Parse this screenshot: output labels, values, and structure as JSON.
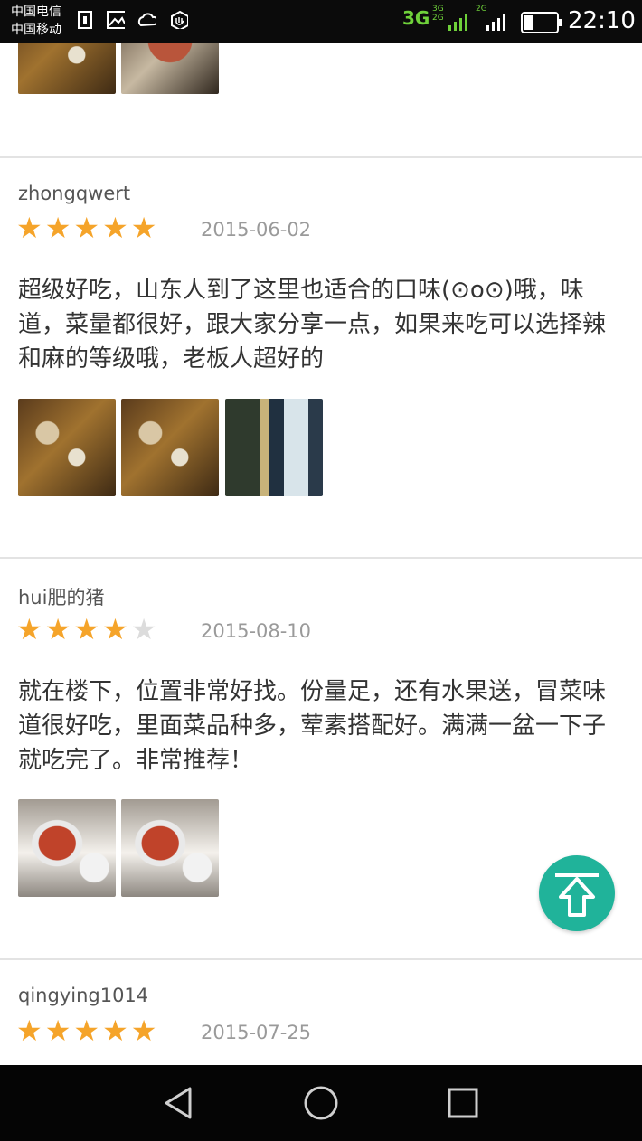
{
  "status_bar": {
    "carrier1": "中国电信",
    "carrier2": "中国移动",
    "network": "3G",
    "sig_small_top": "3G",
    "sig_small_bottom": "2G",
    "sig_small2": "2G",
    "time": "22:10"
  },
  "reviews": [
    {
      "user": "zhongqwert",
      "rating": 5,
      "date": "2015-06-02",
      "text": "超级好吃，山东人到了这里也适合的口味(⊙o⊙)哦，味道，菜量都很好，跟大家分享一点，如果来吃可以选择辣和麻的等级哦，老板人超好的",
      "photos": 3
    },
    {
      "user": "hui肥的猪",
      "rating": 4,
      "date": "2015-08-10",
      "text": "就在楼下，位置非常好找。份量足，还有水果送，冒菜味道很好吃，里面菜品种多，荤素搭配好。满满一盆一下子就吃完了。非常推荐！",
      "photos": 2
    },
    {
      "user": "qingying1014",
      "rating": 5,
      "date": "2015-07-25"
    }
  ],
  "icons": {
    "back": "back-triangle-icon",
    "home": "home-circle-icon",
    "recent": "recent-square-icon",
    "to_top": "arrow-up-icon"
  },
  "colors": {
    "star": "#f5a42a",
    "accent": "#20b39a"
  }
}
